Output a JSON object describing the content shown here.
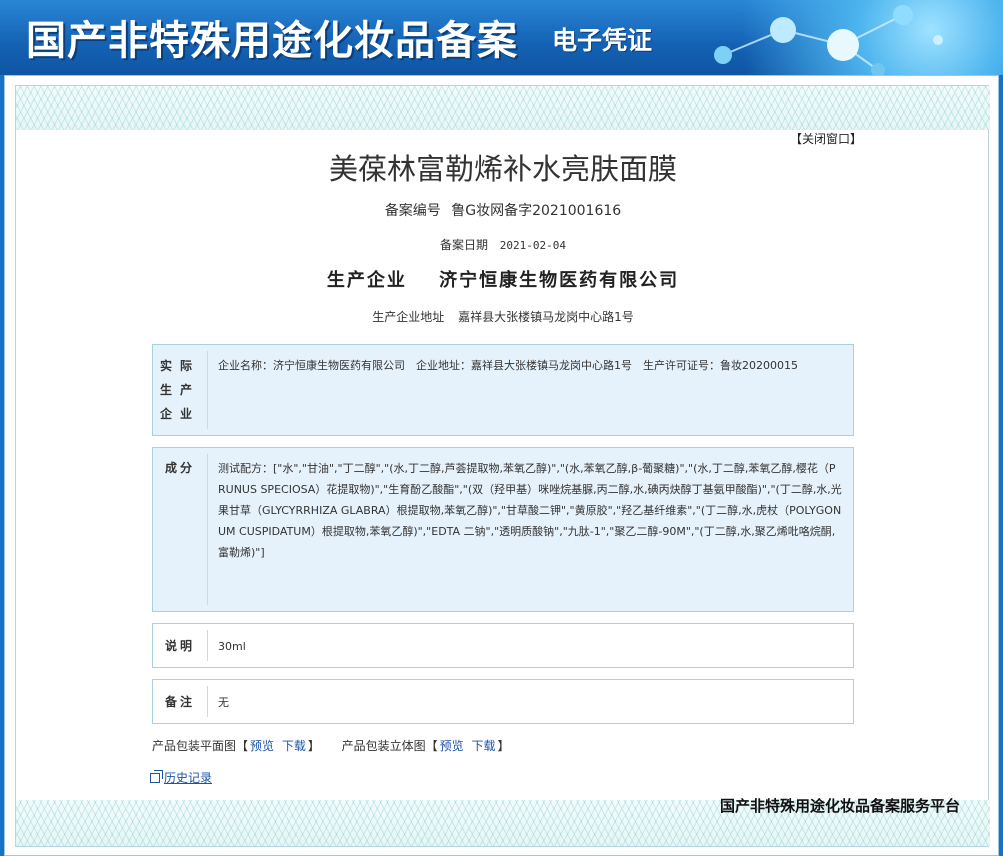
{
  "banner": {
    "title": "国产非特殊用途化妆品备案",
    "subtitle": "电子凭证"
  },
  "close_label": "【关闭窗口】",
  "product": {
    "name": "美葆林富勒烯补水亮肤面膜",
    "reg_no_label": "备案编号",
    "reg_no_value": "鲁G妆网备字2021001616",
    "reg_date_label": "备案日期",
    "reg_date_value": "2021-02-04",
    "company_label": "生产企业",
    "company_value": "济宁恒康生物医药有限公司",
    "address_label": "生产企业地址",
    "address_value": "嘉祥县大张楼镇马龙岗中心路1号"
  },
  "sections": {
    "maker": {
      "label": "实际生产企业",
      "content": "企业名称：济宁恒康生物医药有限公司　企业地址：嘉祥县大张楼镇马龙岗中心路1号　生产许可证号：鲁妆20200015"
    },
    "ingredients": {
      "label": "成分",
      "content": "测试配方：[\"水\",\"甘油\",\"丁二醇\",\"(水,丁二醇,芦荟提取物,苯氧乙醇)\",\"(水,苯氧乙醇,β-葡聚糖)\",\"(水,丁二醇,苯氧乙醇,樱花（PRUNUS SPECIOSA）花提取物)\",\"生育酚乙酸酯\",\"(双（羟甲基）咪唑烷基脲,丙二醇,水,碘丙炔醇丁基氨甲酸酯)\",\"(丁二醇,水,光果甘草（GLYCYRRHIZA GLABRA）根提取物,苯氧乙醇)\",\"甘草酸二钾\",\"黄原胶\",\"羟乙基纤维素\",\"(丁二醇,水,虎杖（POLYGONUM CUSPIDATUM）根提取物,苯氧乙醇)\",\"EDTA 二钠\",\"透明质酸钠\",\"九肽-1\",\"聚乙二醇-90M\",\"(丁二醇,水,聚乙烯吡咯烷酮,富勒烯)\"]"
    },
    "description": {
      "label": "说明",
      "content": "30ml"
    },
    "remark": {
      "label": "备注",
      "content": "无"
    }
  },
  "packaging": {
    "flat_label": "产品包装平面图",
    "solid_label": "产品包装立体图",
    "bracket_open": "【",
    "bracket_close": "】",
    "preview": "预览",
    "download": "下载"
  },
  "history_label": "历史记录",
  "footer_platform": "国产非特殊用途化妆品备案服务平台",
  "colors": {
    "banner_blue": "#1461b3",
    "box_blue": "#e6f2fb",
    "link_blue": "#1a55a4"
  }
}
